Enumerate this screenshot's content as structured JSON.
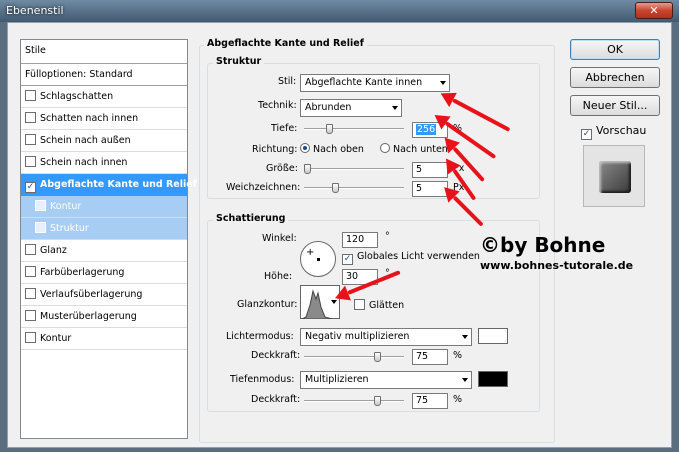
{
  "window": {
    "title": "Ebenenstil",
    "close_glyph": "✕"
  },
  "left_panel": {
    "items": [
      {
        "label": "Stile",
        "checkbox": false,
        "checked": false,
        "state": "plain"
      },
      {
        "label": "Fülloptionen: Standard",
        "checkbox": false,
        "checked": false,
        "state": "plain"
      },
      {
        "label": "Schlagschatten",
        "checkbox": true,
        "checked": false,
        "state": "normal"
      },
      {
        "label": "Schatten nach innen",
        "checkbox": true,
        "checked": false,
        "state": "normal"
      },
      {
        "label": "Schein nach außen",
        "checkbox": true,
        "checked": false,
        "state": "normal"
      },
      {
        "label": "Schein nach innen",
        "checkbox": true,
        "checked": false,
        "state": "normal"
      },
      {
        "label": "Abgeflachte Kante und Relief",
        "checkbox": true,
        "checked": true,
        "state": "selected"
      },
      {
        "label": "Kontur",
        "checkbox": true,
        "checked": false,
        "state": "sub"
      },
      {
        "label": "Struktur",
        "checkbox": true,
        "checked": false,
        "state": "sub"
      },
      {
        "label": "Glanz",
        "checkbox": true,
        "checked": false,
        "state": "normal"
      },
      {
        "label": "Farbüberlagerung",
        "checkbox": true,
        "checked": false,
        "state": "normal"
      },
      {
        "label": "Verlaufsüberlagerung",
        "checkbox": true,
        "checked": false,
        "state": "normal"
      },
      {
        "label": "Musterüberlagerung",
        "checkbox": true,
        "checked": false,
        "state": "normal"
      },
      {
        "label": "Kontur",
        "checkbox": true,
        "checked": false,
        "state": "normal"
      }
    ]
  },
  "main": {
    "section_title": "Abgeflachte Kante und Relief",
    "struktur": {
      "title": "Struktur",
      "stil_label": "Stil:",
      "stil_value": "Abgeflachte Kante innen",
      "technik_label": "Technik:",
      "technik_value": "Abrunden",
      "tiefe_label": "Tiefe:",
      "tiefe_value": "256",
      "tiefe_unit": "%",
      "tiefe_level": 0.25,
      "richtung_label": "Richtung:",
      "nach_oben": "Nach oben",
      "nach_unten": "Nach unten",
      "richtung_selected": "Nach oben",
      "groesse_label": "Größe:",
      "groesse_value": "5",
      "groesse_unit": "Px",
      "groesse_level": 0.02,
      "weich_label": "Weichzeichnen:",
      "weich_value": "5",
      "weich_unit": "Px",
      "weich_level": 0.3
    },
    "schattierung": {
      "title": "Schattierung",
      "winkel_label": "Winkel:",
      "winkel_value": "120",
      "winkel_unit": "°",
      "global_light_label": "Globales Licht verwenden",
      "global_light_checked": true,
      "hoehe_label": "Höhe:",
      "hoehe_value": "30",
      "hoehe_unit": "°",
      "glanzkontur_label": "Glanzkontur:",
      "glaetten_label": "Glätten",
      "glaetten_checked": false,
      "lichtermodus_label": "Lichtermodus:",
      "lichtermodus_value": "Negativ multiplizieren",
      "lichter_color": "#ffffff",
      "deckkraft1_label": "Deckkraft:",
      "deckkraft1_value": "75",
      "deckkraft1_unit": "%",
      "deckkraft1_level": 0.75,
      "tiefenmodus_label": "Tiefenmodus:",
      "tiefenmodus_value": "Multiplizieren",
      "tiefen_color": "#000000",
      "deckkraft2_label": "Deckkraft:",
      "deckkraft2_value": "75",
      "deckkraft2_unit": "%",
      "deckkraft2_level": 0.75
    }
  },
  "buttons": {
    "ok": "OK",
    "cancel": "Abbrechen",
    "new_style": "Neuer Stil...",
    "preview_label": "Vorschau",
    "preview_checked": true
  },
  "watermark": {
    "line1": "©by Bohne",
    "line2": "www.bohnes-tutorale.de"
  },
  "colors": {
    "selection": "#3399ff",
    "arrow": "#e8121a"
  }
}
